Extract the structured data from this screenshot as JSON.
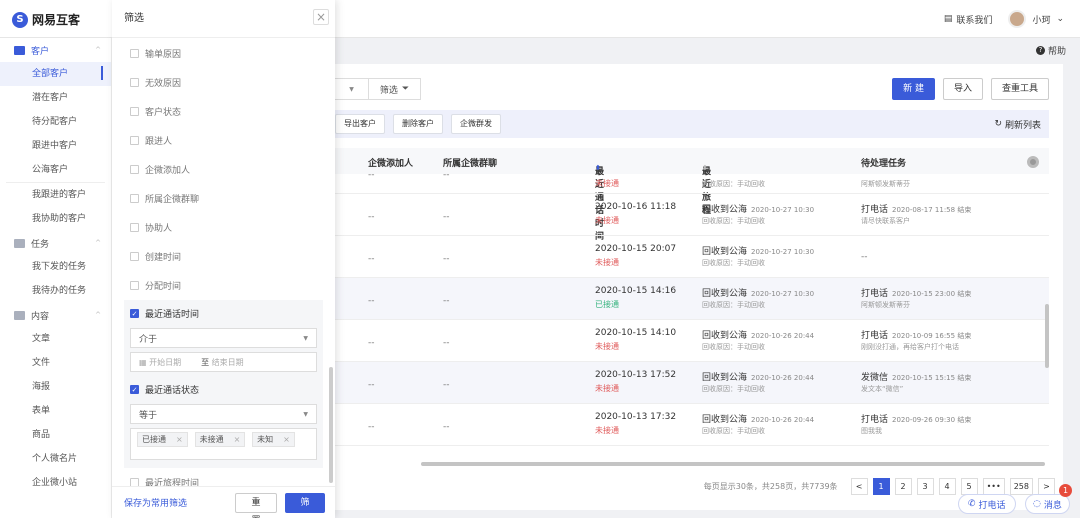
{
  "header": {
    "logo_text": "网易互客",
    "contact": "联系我们",
    "user_name": "小珂"
  },
  "help": "帮助",
  "sidebar": {
    "groups": [
      {
        "label": "客户",
        "items": [
          "全部客户",
          "潜在客户",
          "待分配客户",
          "跟进中客户",
          "公海客户",
          "我跟进的客户",
          "我协助的客户"
        ]
      },
      {
        "label": "任务",
        "items": [
          "我下发的任务",
          "我待办的任务"
        ]
      },
      {
        "label": "内容",
        "items": [
          "文章",
          "文件",
          "海报",
          "表单",
          "商品",
          "个人微名片",
          "企业微小站"
        ]
      }
    ]
  },
  "filter": {
    "title": "筛选",
    "fields": [
      "输单原因",
      "无效原因",
      "客户状态",
      "跟进人",
      "企微添加人",
      "所属企微群聊",
      "协助人",
      "创建时间",
      "分配时间"
    ],
    "recent_call_time": {
      "label": "最近通话时间",
      "operator": "介于",
      "start_placeholder": "开始日期",
      "to": "至",
      "end_placeholder": "结束日期"
    },
    "recent_call_status": {
      "label": "最近通话状态",
      "operator": "等于",
      "tags": [
        "已接通",
        "未接通",
        "未知"
      ]
    },
    "next_field": "最近旅程时间",
    "save_label": "保存为常用筛选",
    "reset_label": "重 置",
    "apply_label": "筛 选"
  },
  "toolbar": {
    "filter_label": "筛选",
    "new_label": "新 建",
    "import_label": "导入",
    "dedup_label": "查重工具",
    "export_label": "导出客户",
    "delete_label": "删除客户",
    "group_send_label": "企微群发",
    "refresh_label": "刷新列表"
  },
  "table": {
    "headers": {
      "adder": "企微添加人",
      "group": "所属企微群聊",
      "call_time": "最近通话时间",
      "journey": "最近旅程",
      "task": "待处理任务"
    },
    "partial_row": {
      "adder": "--",
      "group": "--",
      "status": "未接通",
      "journey_sub": "回收原因：手动回收",
      "task_sub": "阿斯顿发斯蒂芬"
    },
    "rows": [
      {
        "adder": "--",
        "group": "--",
        "time": "2020-10-16 11:18",
        "status": "未接通",
        "status_color": "red",
        "journey": "回收到公海",
        "journey_date": "2020-10-27 10:30",
        "journey_sub": "回收原因：手动回收",
        "task": "打电话",
        "task_date": "2020-08-17 11:58 结束",
        "task_sub": "请尽快联系客户"
      },
      {
        "adder": "--",
        "group": "--",
        "time": "2020-10-15 20:07",
        "status": "未接通",
        "status_color": "red",
        "journey": "回收到公海",
        "journey_date": "2020-10-27 10:30",
        "journey_sub": "回收原因：手动回收",
        "task": "--",
        "task_date": "",
        "task_sub": ""
      },
      {
        "adder": "--",
        "group": "--",
        "time": "2020-10-15 14:16",
        "status": "已接通",
        "status_color": "green",
        "journey": "回收到公海",
        "journey_date": "2020-10-27 10:30",
        "journey_sub": "回收原因：手动回收",
        "task": "打电话",
        "task_date": "2020-10-15 23:00 结束",
        "task_sub": "阿斯顿发斯蒂芬"
      },
      {
        "adder": "--",
        "group": "--",
        "time": "2020-10-15 14:10",
        "status": "未接通",
        "status_color": "red",
        "journey": "回收到公海",
        "journey_date": "2020-10-26 20:44",
        "journey_sub": "回收原因：手动回收",
        "task": "打电话",
        "task_date": "2020-10-09 16:55 结束",
        "task_sub": "刚刚没打通，再给客户打个电话"
      },
      {
        "adder": "--",
        "group": "--",
        "time": "2020-10-13 17:52",
        "status": "未接通",
        "status_color": "red",
        "journey": "回收到公海",
        "journey_date": "2020-10-26 20:44",
        "journey_sub": "回收原因：手动回收",
        "task": "发微信",
        "task_date": "2020-10-15 15:15 结束",
        "task_sub": "发文本“微信”"
      },
      {
        "adder": "--",
        "group": "--",
        "time": "2020-10-13 17:32",
        "status": "未接通",
        "status_color": "red",
        "journey": "回收到公海",
        "journey_date": "2020-10-26 20:44",
        "journey_sub": "回收原因：手动回收",
        "task": "打电话",
        "task_date": "2020-09-26 09:30 结束",
        "task_sub": "图我我"
      }
    ]
  },
  "pagination": {
    "info": "每页显示30条，共258页，共7739条",
    "pages": [
      "1",
      "2",
      "3",
      "4",
      "5",
      "•••",
      "258"
    ],
    "current": "1"
  },
  "float": {
    "call_label": "打电话",
    "msg_label": "消息",
    "badge": "1"
  },
  "colors": {
    "accent": "#3a5bd9",
    "red": "#e05a5a",
    "green": "#36b37e"
  }
}
